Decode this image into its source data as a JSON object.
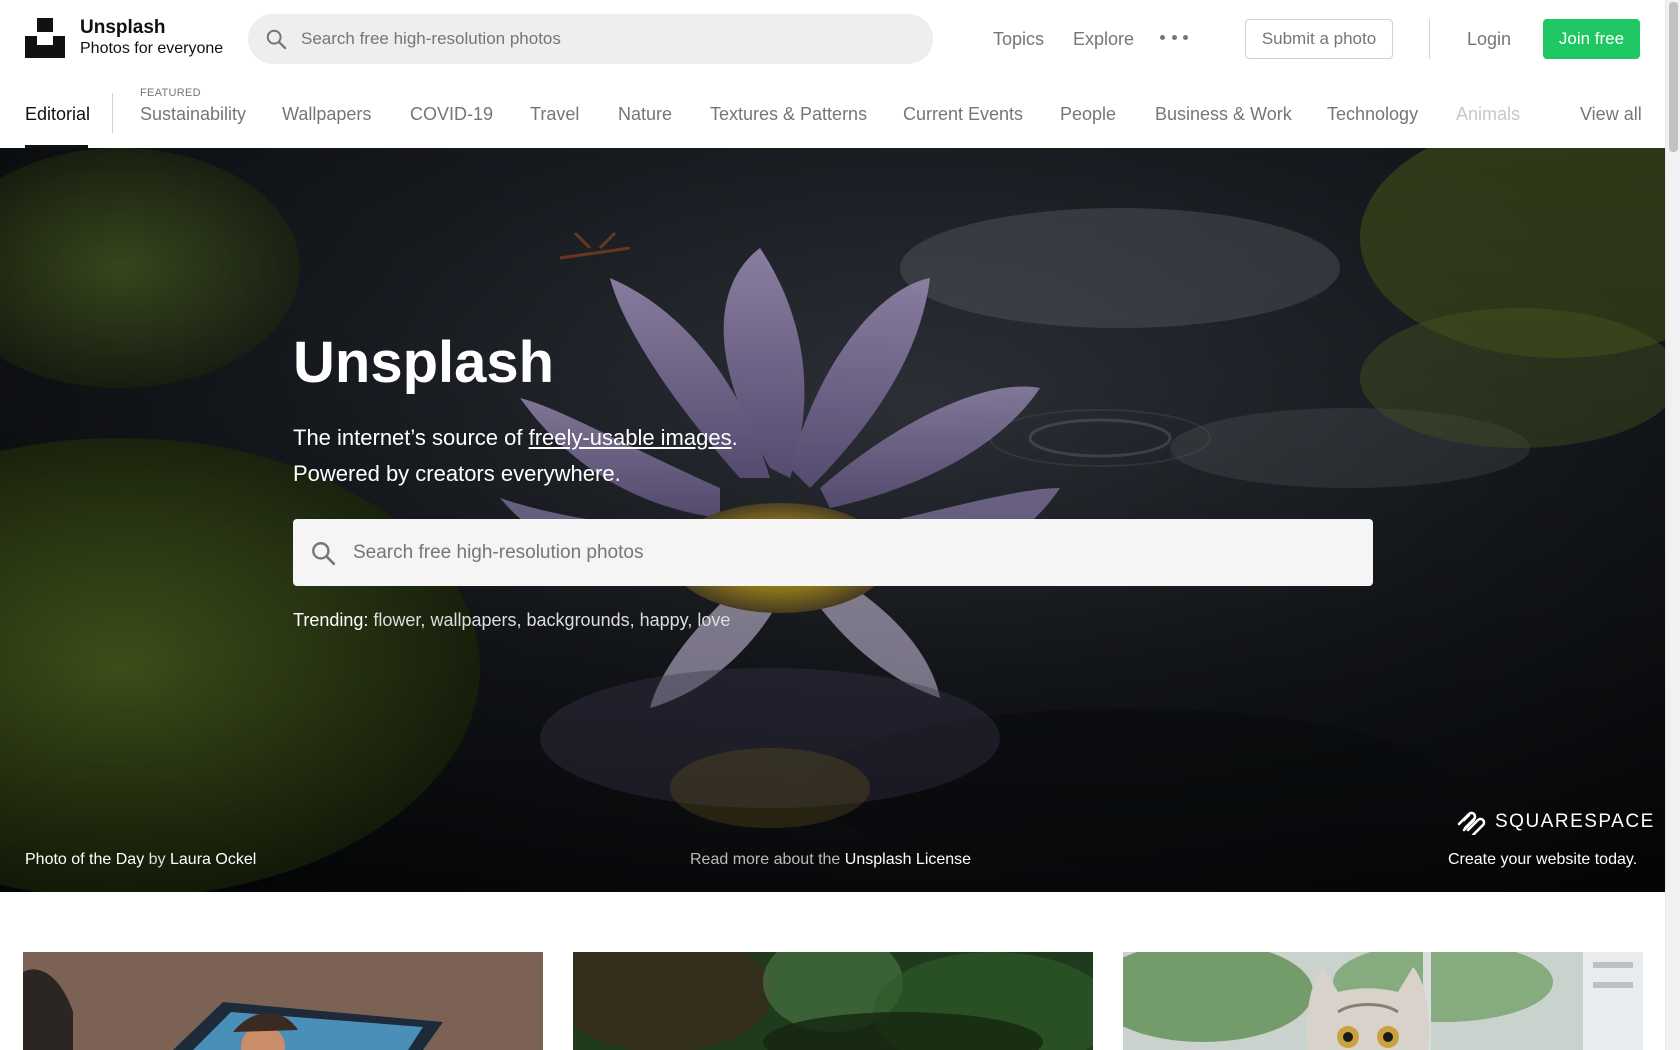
{
  "header": {
    "brand_name": "Unsplash",
    "brand_tagline": "Photos for everyone",
    "search_placeholder": "Search free high-resolution photos",
    "nav": [
      "Topics",
      "Explore"
    ],
    "submit_label": "Submit a photo",
    "login_label": "Login",
    "join_label": "Join free"
  },
  "topics": {
    "active": "Editorial",
    "featured_label": "FEATURED",
    "items": [
      "Sustainability",
      "Wallpapers",
      "COVID-19",
      "Travel",
      "Nature",
      "Textures & Patterns",
      "Current Events",
      "People",
      "Business & Work",
      "Technology",
      "Animals"
    ],
    "view_all": "View all"
  },
  "hero": {
    "title": "Unsplash",
    "subtitle_prefix": "The internet’s source of ",
    "subtitle_link": "freely-usable images",
    "subtitle_suffix": ".",
    "subtitle_line2": "Powered by creators everywhere.",
    "search_placeholder": "Search free high-resolution photos",
    "trending_label": "Trending:",
    "trending": [
      "flower",
      "wallpapers",
      "backgrounds",
      "happy",
      "love"
    ],
    "photo_of_day_label": "Photo of the Day",
    "by_label": "by",
    "photographer": "Laura Ockel",
    "license_prefix": "Read more about the",
    "license_link": "Unsplash License",
    "sponsor_name": "SQUARESPACE",
    "sponsor_tagline": "Create your website today."
  },
  "colors": {
    "join_button": "#1ec761",
    "muted_text": "#767676"
  }
}
